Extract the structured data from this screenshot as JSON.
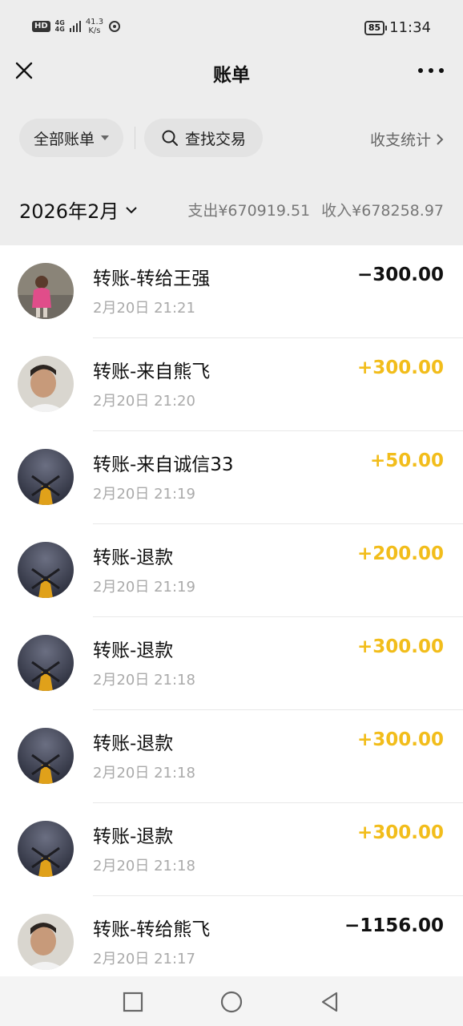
{
  "status_bar": {
    "hd": "HD",
    "network": [
      "4G",
      "4G"
    ],
    "speed_value": "41.3",
    "speed_unit": "K/s",
    "battery": "85",
    "time": "11:34"
  },
  "header": {
    "title": "账单",
    "close_icon": "close-icon",
    "more_icon": "more-icon"
  },
  "filters": {
    "all_bills_label": "全部账单",
    "search_label": "查找交易",
    "stats_label": "收支统计"
  },
  "month": {
    "label": "2026年2月",
    "expense": "支出¥670919.51",
    "income": "收入¥678258.97"
  },
  "transactions": [
    {
      "title": "转账-转给王强",
      "time": "2月20日 21:21",
      "amount": "−300.00",
      "direction": "out",
      "avatar": "child-photo"
    },
    {
      "title": "转账-来自熊飞",
      "time": "2月20日 21:20",
      "amount": "+300.00",
      "direction": "in",
      "avatar": "man-photo"
    },
    {
      "title": "转账-来自诚信33",
      "time": "2月20日 21:19",
      "amount": "+50.00",
      "direction": "in",
      "avatar": "windmill-night"
    },
    {
      "title": "转账-退款",
      "time": "2月20日 21:19",
      "amount": "+200.00",
      "direction": "in",
      "avatar": "windmill-night"
    },
    {
      "title": "转账-退款",
      "time": "2月20日 21:18",
      "amount": "+300.00",
      "direction": "in",
      "avatar": "windmill-night"
    },
    {
      "title": "转账-退款",
      "time": "2月20日 21:18",
      "amount": "+300.00",
      "direction": "in",
      "avatar": "windmill-night"
    },
    {
      "title": "转账-退款",
      "time": "2月20日 21:18",
      "amount": "+300.00",
      "direction": "in",
      "avatar": "windmill-night"
    },
    {
      "title": "转账-转给熊飞",
      "time": "2月20日 21:17",
      "amount": "−1156.00",
      "direction": "out",
      "avatar": "man-photo"
    }
  ],
  "colors": {
    "income": "#f2bd1b",
    "expense": "#111111",
    "background": "#ededed"
  },
  "nav": {
    "recent_icon": "square-icon",
    "home_icon": "circle-icon",
    "back_icon": "triangle-back-icon"
  }
}
